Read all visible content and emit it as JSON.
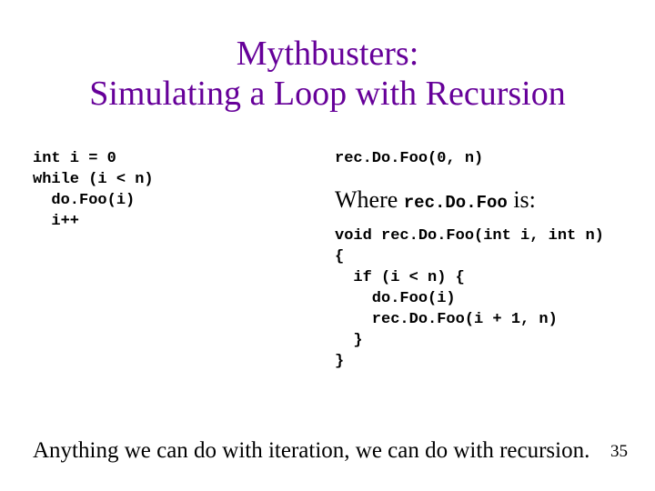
{
  "title_line1": "Mythbusters:",
  "title_line2": "Simulating a Loop with Recursion",
  "left_code": "int i = 0\nwhile (i < n)\n  do.Foo(i)\n  i++",
  "right_call": "rec.Do.Foo(0, n)",
  "where_prefix": "Where ",
  "where_code": "rec.Do.Foo",
  "where_suffix": " is:",
  "right_def": "void rec.Do.Foo(int i, int n)\n{\n  if (i < n) {\n    do.Foo(i)\n    rec.Do.Foo(i + 1, n)\n  }\n}",
  "bottom_text": "Anything we can do with iteration, we can do with recursion.",
  "page_number": "35"
}
